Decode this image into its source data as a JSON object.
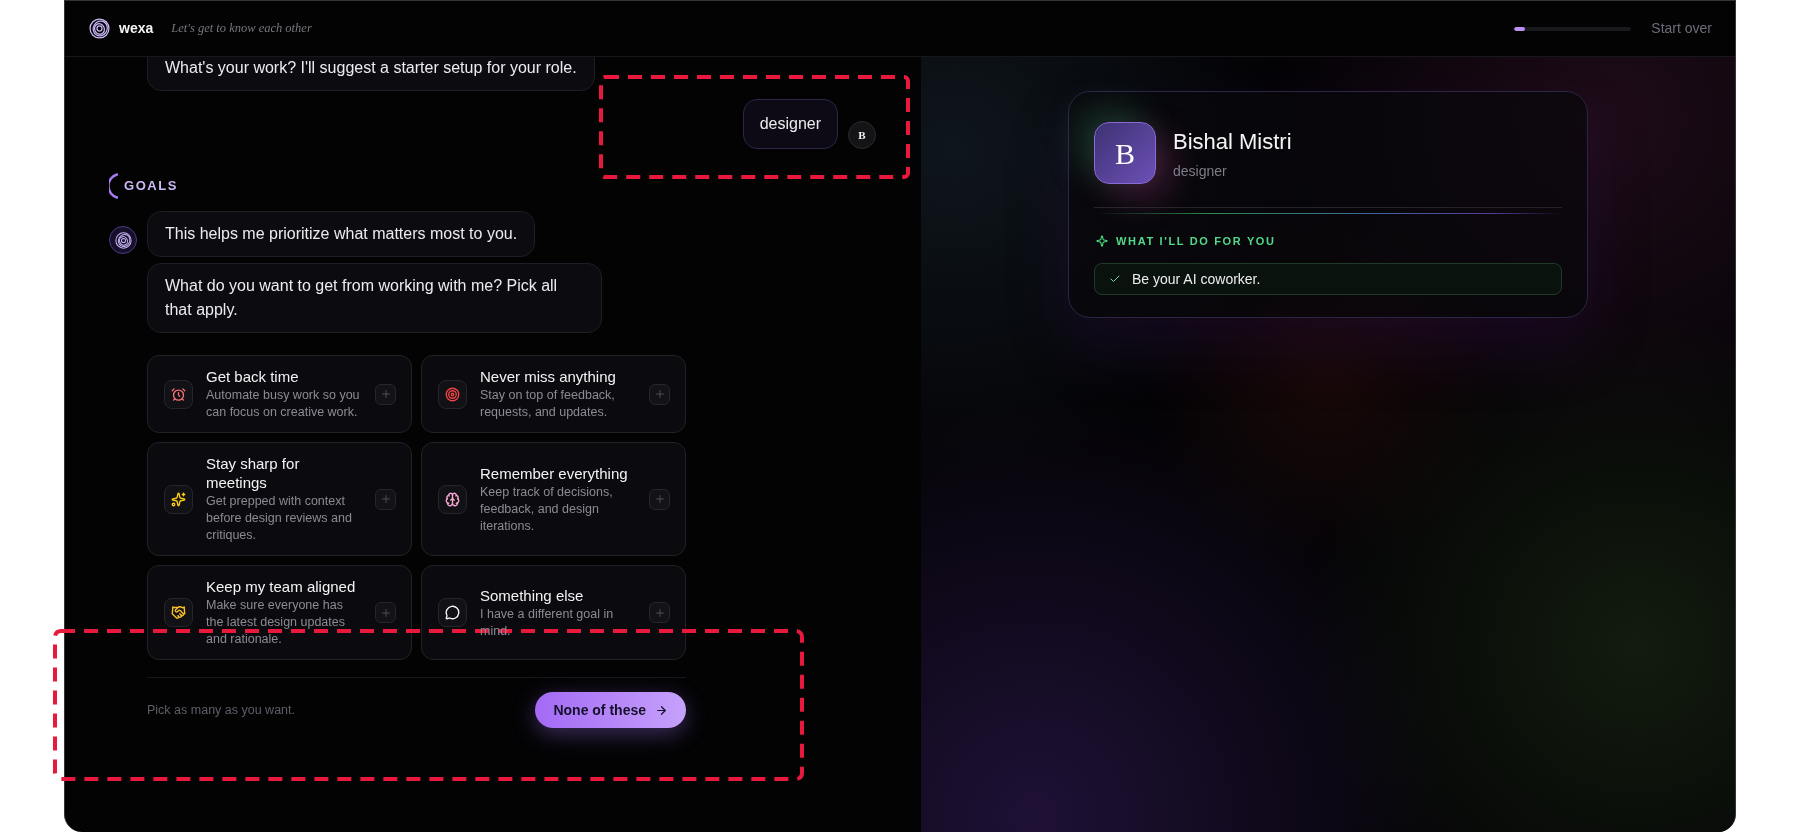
{
  "header": {
    "brand": "wexa",
    "tagline": "Let's get to know each other",
    "progress": {
      "level": 0.09
    },
    "start_over": "Start over"
  },
  "conversation": [
    {
      "kind": "assistant",
      "show_avatar": false,
      "bubbles": [
        "What's your work? I'll suggest a starter setup for your role."
      ]
    },
    {
      "kind": "user",
      "text": "designer",
      "avatar": "B"
    },
    {
      "kind": "section",
      "label": "GOALS"
    },
    {
      "kind": "assistant",
      "show_avatar": true,
      "bubbles": [
        "This helps me prioritize what matters most to you.",
        "What do you want to get from working with me? Pick all that apply."
      ]
    }
  ],
  "goals": {
    "options": [
      {
        "title": "Get back time",
        "description": "Automate busy work so you can focus on creative work.",
        "selected": false
      },
      {
        "title": "Never miss anything",
        "description": "Stay on top of feedback, requests, and updates.",
        "selected": false
      },
      {
        "title": "Stay sharp for meetings",
        "description": "Get prepped with context before design reviews and critiques.",
        "selected": false
      },
      {
        "title": "Remember everything",
        "description": "Keep track of decisions, feedback, and design iterations.",
        "selected": false
      },
      {
        "title": "Keep my team aligned",
        "description": "Make sure everyone has the latest design updates and rationale.",
        "selected": false
      },
      {
        "title": "Something else",
        "description": "I have a different goal in mind.",
        "selected": false
      }
    ],
    "hint": "Pick as many as you want.",
    "skip_button": "None of these"
  },
  "profile": {
    "initial": "B",
    "name": "Bishal Mistri",
    "role": "designer",
    "section_title": "WHAT I'LL DO FOR YOU",
    "items": [
      "Be your AI coworker."
    ]
  }
}
